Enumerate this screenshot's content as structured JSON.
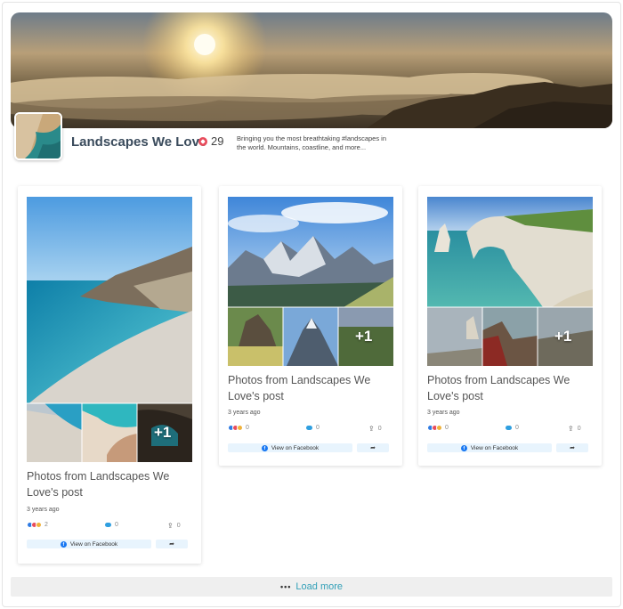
{
  "page": {
    "name": "Landscapes We Love",
    "likes": "29",
    "about": "Bringing you the most breathtaking #landscapes in the world. Mountains, coastline, and more..."
  },
  "posts": [
    {
      "title": "Photos from Landscapes We Love's post",
      "time": "3 years ago",
      "reactions": "2",
      "comments": "0",
      "shares": "0",
      "more_photos": "+1",
      "view_label": "View on Facebook"
    },
    {
      "title": "Photos from Landscapes We Love's post",
      "time": "3 years ago",
      "reactions": "0",
      "comments": "0",
      "shares": "0",
      "more_photos": "+1",
      "view_label": "View on Facebook"
    },
    {
      "title": "Photos from Landscapes We Love's post",
      "time": "3 years ago",
      "reactions": "0",
      "comments": "0",
      "shares": "0",
      "more_photos": "+1",
      "view_label": "View on Facebook"
    }
  ],
  "load_more": "Load more",
  "icons": {
    "heart": "heart-icon",
    "comment": "comment-icon",
    "share": "share-icon",
    "facebook": "facebook-icon",
    "forward": "forward-icon",
    "more": "ellipsis-icon"
  },
  "colors": {
    "accent": "#33a0b8",
    "facebook": "#1877f2",
    "heart": "#e84c5c",
    "button_bg": "#e8f4fd"
  }
}
